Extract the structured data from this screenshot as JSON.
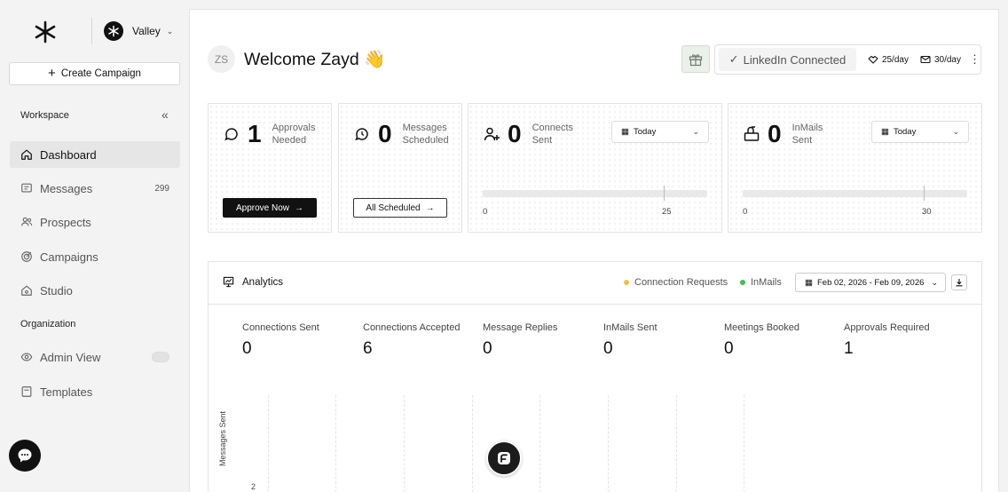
{
  "workspace": {
    "name": "Valley"
  },
  "sidebar": {
    "create_label": "Create Campaign",
    "workspace_label": "Workspace",
    "organization_label": "Organization",
    "items": [
      {
        "label": "Dashboard",
        "icon": "home-icon",
        "active": true
      },
      {
        "label": "Messages",
        "icon": "message-icon",
        "count": "299"
      },
      {
        "label": "Prospects",
        "icon": "users-icon"
      },
      {
        "label": "Campaigns",
        "icon": "target-icon"
      },
      {
        "label": "Studio",
        "icon": "studio-icon"
      }
    ],
    "org_items": [
      {
        "label": "Admin View",
        "icon": "eye-icon",
        "toggle": false
      },
      {
        "label": "Templates",
        "icon": "template-icon"
      }
    ]
  },
  "header": {
    "avatar_initials": "ZS",
    "welcome": "Welcome Zayd 👋",
    "linkedin_status": "LinkedIn Connected",
    "connect_limit": "25/day",
    "inmail_limit": "30/day"
  },
  "cards": {
    "approvals": {
      "value": "1",
      "label_line1": "Approvals",
      "label_line2": "Needed",
      "button": "Approve Now"
    },
    "messages": {
      "value": "0",
      "label_line1": "Messages",
      "label_line2": "Scheduled",
      "button": "All Scheduled"
    },
    "connects": {
      "value": "0",
      "label_line1": "Connects",
      "label_line2": "Sent",
      "range": "Today",
      "min": "0",
      "max": "25",
      "progress": 0
    },
    "inmails": {
      "value": "0",
      "label_line1": "InMails",
      "label_line2": "Sent",
      "range": "Today",
      "min": "0",
      "max": "30",
      "progress": 0
    }
  },
  "analytics": {
    "title": "Analytics",
    "legend": [
      {
        "label": "Connection Requests",
        "color": "#f0c04a"
      },
      {
        "label": "InMails",
        "color": "#3cbf55"
      }
    ],
    "date_range": "Feb 02, 2026 - Feb 09, 2026",
    "metrics": [
      {
        "label": "Connections Sent",
        "value": "0"
      },
      {
        "label": "Connections Accepted",
        "value": "6"
      },
      {
        "label": "Message Replies",
        "value": "0"
      },
      {
        "label": "InMails Sent",
        "value": "0"
      },
      {
        "label": "Meetings Booked",
        "value": "0"
      },
      {
        "label": "Approvals Required",
        "value": "1"
      }
    ],
    "y_axis_label": "Messages Sent",
    "y_tick_top": "2"
  },
  "colors": {
    "accent": "#111111",
    "active_nav": "#e6e6e6"
  }
}
